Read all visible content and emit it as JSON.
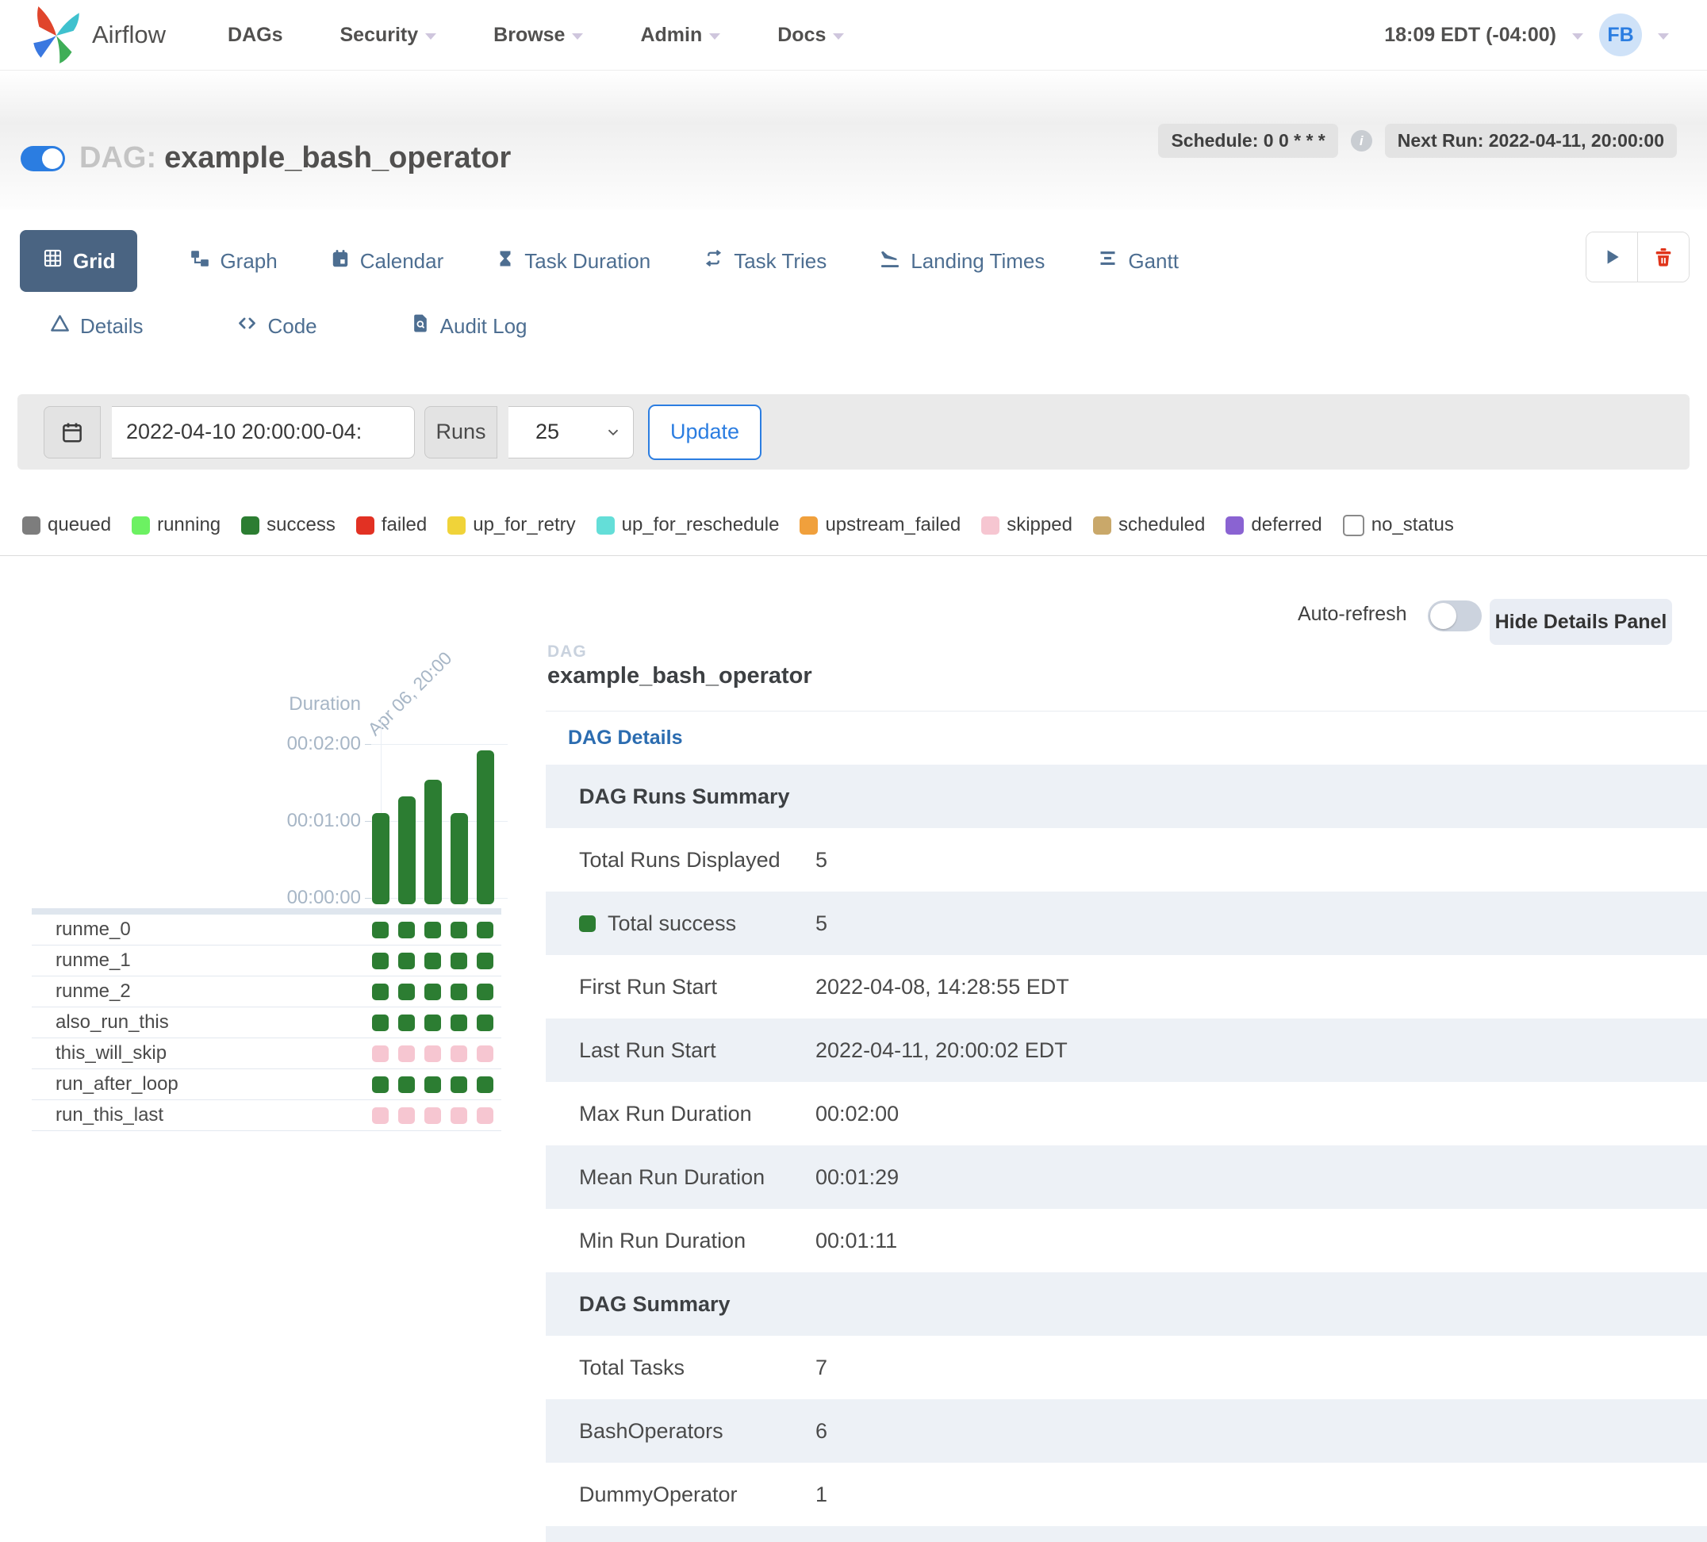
{
  "navbar": {
    "brand": "Airflow",
    "items": [
      {
        "label": "DAGs",
        "caret": false
      },
      {
        "label": "Security",
        "caret": true
      },
      {
        "label": "Browse",
        "caret": true
      },
      {
        "label": "Admin",
        "caret": true
      },
      {
        "label": "Docs",
        "caret": true
      }
    ],
    "clock": "18:09 EDT (-04:00)",
    "avatar_initials": "FB"
  },
  "dag_header": {
    "prefix": "DAG:",
    "name": "example_bash_operator",
    "schedule_badge": "Schedule: 0 0 * * *",
    "info_glyph": "i",
    "next_run_badge": "Next Run: 2022-04-11, 20:00:00"
  },
  "view_tabs": {
    "row1": [
      {
        "label": "Grid",
        "icon": "grid-icon",
        "active": true
      },
      {
        "label": "Graph",
        "icon": "graph-icon",
        "active": false
      },
      {
        "label": "Calendar",
        "icon": "calendar-icon",
        "active": false
      },
      {
        "label": "Task Duration",
        "icon": "hourglass-icon",
        "active": false
      },
      {
        "label": "Task Tries",
        "icon": "repeat-icon",
        "active": false
      },
      {
        "label": "Landing Times",
        "icon": "landing-plane-icon",
        "active": false
      },
      {
        "label": "Gantt",
        "icon": "gantt-icon",
        "active": false
      }
    ],
    "row2": [
      {
        "label": "Details",
        "icon": "details-triangle-icon",
        "active": false
      },
      {
        "label": "Code",
        "icon": "code-icon",
        "active": false
      },
      {
        "label": "Audit Log",
        "icon": "audit-log-icon",
        "active": false
      }
    ],
    "toolbar_icons": [
      "play-icon",
      "trash-icon"
    ]
  },
  "filter_bar": {
    "calendar_icon": "calendar-icon",
    "date_value": "2022-04-10 20:00:00-04:",
    "runs_label": "Runs",
    "runs_value": "25",
    "update_label": "Update"
  },
  "legend": [
    {
      "label": "queued",
      "color": "#7d7d7d",
      "border": ""
    },
    {
      "label": "running",
      "color": "#6cf162",
      "border": ""
    },
    {
      "label": "success",
      "color": "#2c7d32",
      "border": ""
    },
    {
      "label": "failed",
      "color": "#e23123",
      "border": ""
    },
    {
      "label": "up_for_retry",
      "color": "#f0d339",
      "border": ""
    },
    {
      "label": "up_for_reschedule",
      "color": "#64ded8",
      "border": ""
    },
    {
      "label": "upstream_failed",
      "color": "#f0a03c",
      "border": ""
    },
    {
      "label": "skipped",
      "color": "#f6c6d1",
      "border": ""
    },
    {
      "label": "scheduled",
      "color": "#c9a86a",
      "border": ""
    },
    {
      "label": "deferred",
      "color": "#8a63d2",
      "border": ""
    },
    {
      "label": "no_status",
      "color": "#ffffff",
      "border": "#8a8a8a"
    }
  ],
  "panel_controls": {
    "auto_refresh_label": "Auto-refresh",
    "hide_button_label": "Hide Details Panel"
  },
  "chart_data": {
    "type": "bar",
    "title": "Duration",
    "first_run_label": "Apr 06, 20:00",
    "run_durations_seconds": [
      71,
      84,
      97,
      71,
      120
    ],
    "run_status": [
      "success",
      "success",
      "success",
      "success",
      "success"
    ],
    "bar_color": "#2c7d32",
    "yticks": [
      "00:00:00",
      "00:01:00",
      "00:02:00"
    ],
    "ylim_seconds": [
      0,
      120
    ],
    "grid": true
  },
  "task_grid": {
    "runs_per_task": 5,
    "status_colors": {
      "success": "#2c7d32",
      "skipped": "#f6c6d1"
    },
    "tasks": [
      {
        "name": "runme_0",
        "status": "success"
      },
      {
        "name": "runme_1",
        "status": "success"
      },
      {
        "name": "runme_2",
        "status": "success"
      },
      {
        "name": "also_run_this",
        "status": "success"
      },
      {
        "name": "this_will_skip",
        "status": "skipped"
      },
      {
        "name": "run_after_loop",
        "status": "success"
      },
      {
        "name": "run_this_last",
        "status": "skipped"
      }
    ]
  },
  "details_panel": {
    "type_label": "DAG",
    "name": "example_bash_operator",
    "tab_label": "DAG Details",
    "rows": [
      {
        "type": "header",
        "label": "DAG Runs Summary",
        "value": ""
      },
      {
        "type": "data",
        "label": "Total Runs Displayed",
        "value": "5",
        "swatch": ""
      },
      {
        "type": "data",
        "label": "Total success",
        "value": "5",
        "swatch": "#2c7d32"
      },
      {
        "type": "data",
        "label": "First Run Start",
        "value": "2022-04-08, 14:28:55 EDT",
        "swatch": ""
      },
      {
        "type": "data",
        "label": "Last Run Start",
        "value": "2022-04-11, 20:00:02 EDT",
        "swatch": ""
      },
      {
        "type": "data",
        "label": "Max Run Duration",
        "value": "00:02:00",
        "swatch": ""
      },
      {
        "type": "data",
        "label": "Mean Run Duration",
        "value": "00:01:29",
        "swatch": ""
      },
      {
        "type": "data",
        "label": "Min Run Duration",
        "value": "00:01:11",
        "swatch": ""
      },
      {
        "type": "header",
        "label": "DAG Summary",
        "value": ""
      },
      {
        "type": "data",
        "label": "Total Tasks",
        "value": "7",
        "swatch": ""
      },
      {
        "type": "data",
        "label": "BashOperators",
        "value": "6",
        "swatch": ""
      },
      {
        "type": "data",
        "label": "DummyOperator",
        "value": "1",
        "swatch": ""
      },
      {
        "type": "header-partial",
        "label": "",
        "value": ""
      }
    ]
  }
}
